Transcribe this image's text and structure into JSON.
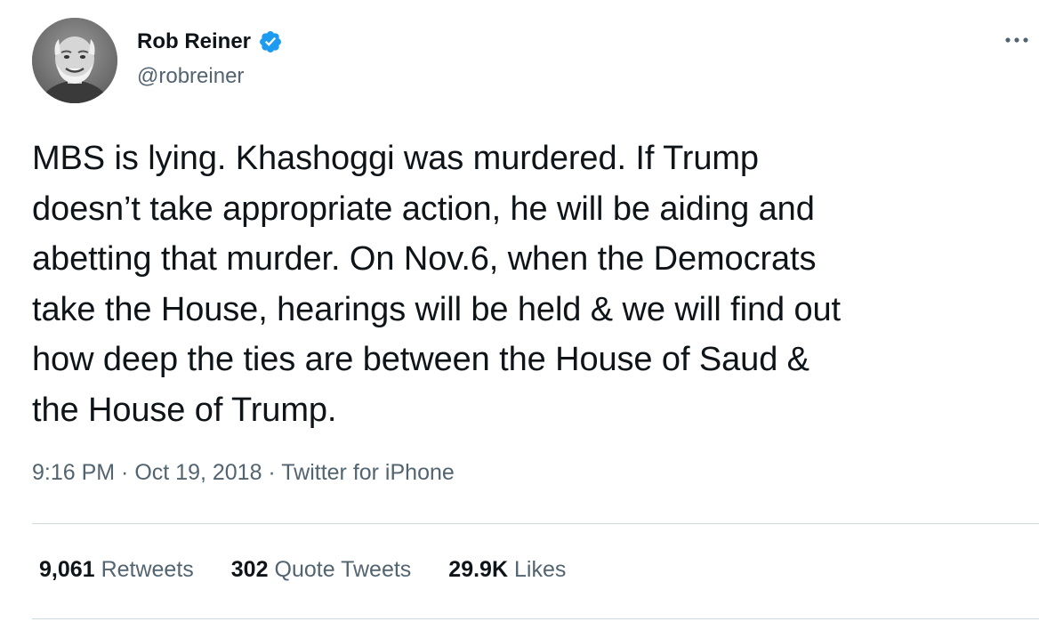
{
  "author": {
    "display_name": "Rob Reiner",
    "handle": "@robreiner",
    "verified": true,
    "avatar_icon": "profile-photo"
  },
  "tweet": {
    "lines": [
      "MBS is lying. Khashoggi was murdered. If Trump",
      "doesn’t take appropriate action, he will be aiding and",
      "abetting that murder. On Nov.6, when the Democrats",
      "take the House, hearings will be held & we will find out",
      "how deep the ties are between the House of Saud &",
      "the House of Trump."
    ]
  },
  "meta": {
    "time": "9:16 PM",
    "separator": " · ",
    "date": "Oct 19, 2018",
    "source": "Twitter for iPhone"
  },
  "stats": {
    "retweets_count": "9,061",
    "retweets_label": "Retweets",
    "quotes_count": "302",
    "quotes_label": "Quote Tweets",
    "likes_count": "29.9K",
    "likes_label": "Likes"
  },
  "colors": {
    "text_primary": "#0f1419",
    "text_secondary": "#536471",
    "verified_blue": "#1d9bf0",
    "divider": "#cfd9de"
  },
  "icons": {
    "verified": "verified-badge-icon",
    "more": "more-options-icon"
  }
}
